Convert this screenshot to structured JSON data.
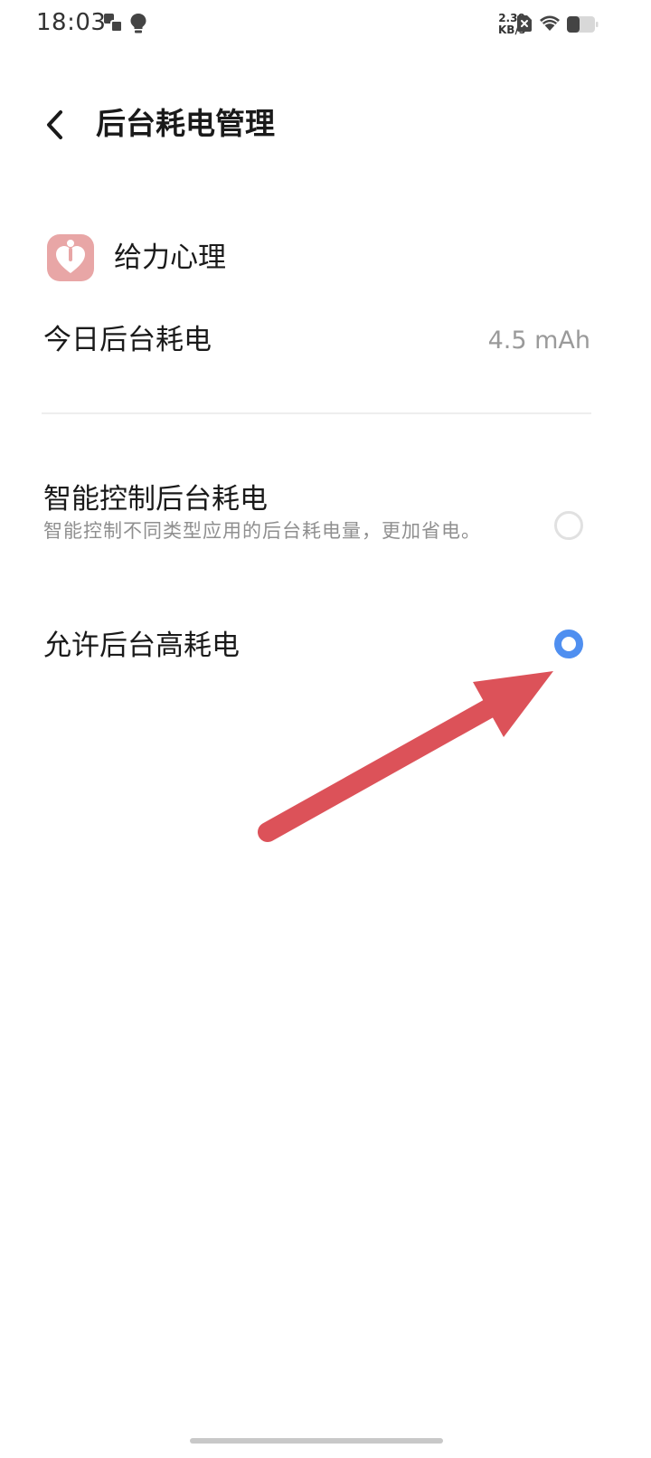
{
  "status_bar": {
    "time": "18:03",
    "net_speed_value": "2.30",
    "net_speed_unit": "KB/s",
    "icons": [
      "screen-mirror-icon",
      "bulb-icon",
      "no-sim-icon",
      "wifi-icon",
      "battery-icon"
    ]
  },
  "header": {
    "title": "后台耗电管理",
    "back_icon": "chevron-left-icon"
  },
  "app": {
    "name": "给力心理",
    "icon": "heart-person-icon",
    "icon_color": "#e8a6a6"
  },
  "usage": {
    "label": "今日后台耗电",
    "value": "4.5 mAh"
  },
  "options": [
    {
      "title": "智能控制后台耗电",
      "description": "智能控制不同类型应用的后台耗电量，更加省电。",
      "selected": false
    },
    {
      "title": "允许后台高耗电",
      "selected": true
    }
  ],
  "colors": {
    "accent": "#4f8ff0",
    "annotation_arrow": "#dc5259"
  }
}
